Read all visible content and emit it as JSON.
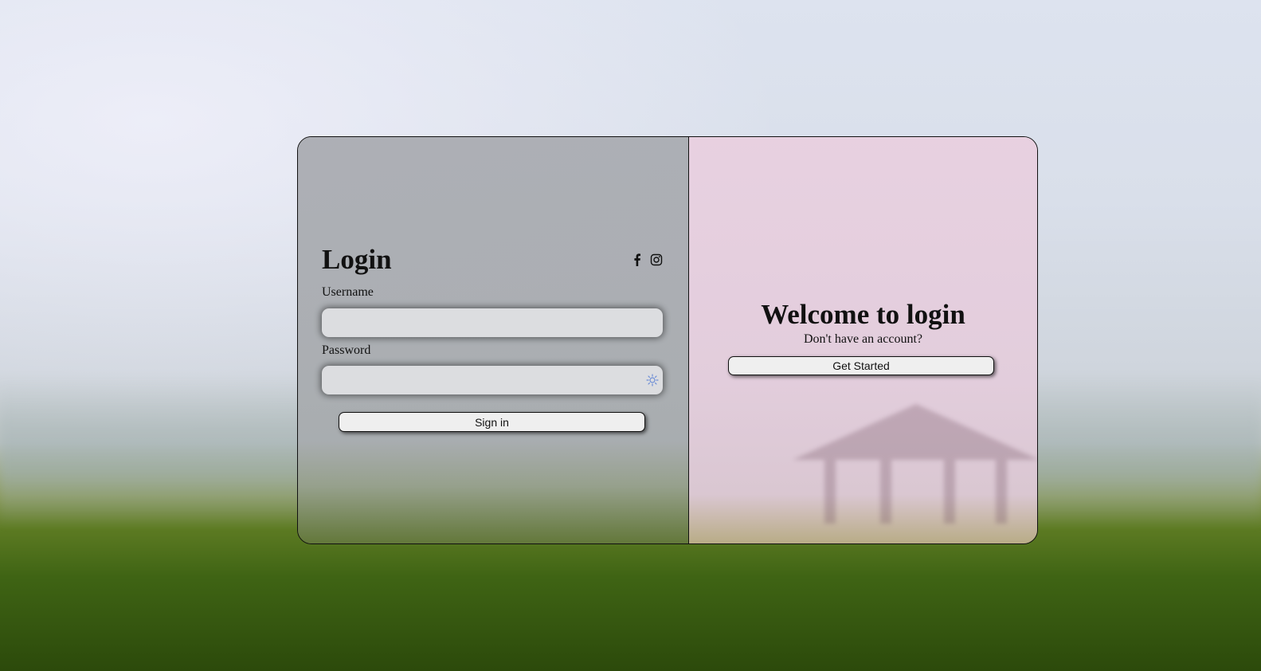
{
  "login": {
    "title": "Login",
    "username_label": "Username",
    "username_value": "",
    "password_label": "Password",
    "password_value": "",
    "sign_in_label": "Sign in",
    "social_icons": [
      "facebook-icon",
      "instagram-icon"
    ]
  },
  "welcome": {
    "title": "Welcome to login",
    "subtitle": "Don't have an account?",
    "get_started_label": "Get Started"
  },
  "colors": {
    "left_panel": "#a9abaf",
    "right_panel": "#e4cfdd",
    "input_bg": "#dcdde0",
    "button_bg": "#efefef",
    "password_icon": "#6b8cd6"
  }
}
